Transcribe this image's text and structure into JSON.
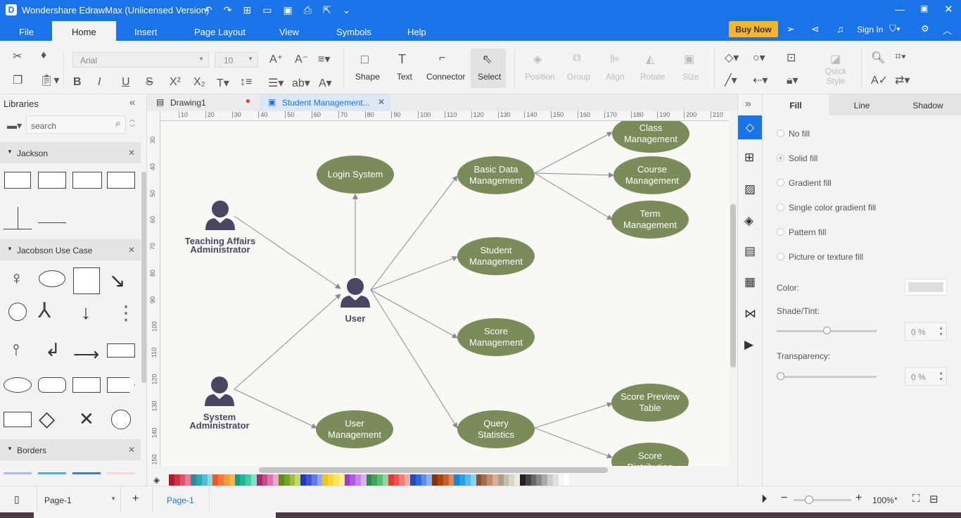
{
  "app": {
    "title": "Wondershare EdrawMax (Unlicensed Version)",
    "buy_now": "Buy Now",
    "sign_in": "Sign In"
  },
  "menu": [
    "File",
    "Home",
    "Insert",
    "Page Layout",
    "View",
    "Symbols",
    "Help"
  ],
  "ribbon": {
    "font": "Arial",
    "size": "10",
    "shape": "Shape",
    "text": "Text",
    "connector": "Connector",
    "select": "Select",
    "position": "Position",
    "group": "Group",
    "align": "Align",
    "rotate": "Rotate",
    "size_lbl": "Size",
    "quick_style": "Quick Style"
  },
  "libraries": {
    "title": "Libraries",
    "search_placeholder": "search",
    "sections": [
      "Jackson",
      "Jacobson Use Case",
      "Borders"
    ]
  },
  "tabs": [
    {
      "label": "Drawing1"
    },
    {
      "label": "Student Management..."
    }
  ],
  "ruler_h": [
    "10",
    "20",
    "30",
    "40",
    "50",
    "60",
    "70",
    "80",
    "90",
    "100",
    "110",
    "120",
    "130",
    "140",
    "150",
    "160",
    "170",
    "180",
    "190",
    "200",
    "210"
  ],
  "ruler_v": [
    "30",
    "40",
    "50",
    "60",
    "70",
    "80",
    "90",
    "100",
    "110",
    "120",
    "130",
    "140",
    "150"
  ],
  "diagram": {
    "actors": [
      {
        "id": "ta",
        "label": "Teaching Affairs Administrator"
      },
      {
        "id": "user",
        "label": "User"
      },
      {
        "id": "sa",
        "label": "System Administrator"
      }
    ],
    "use_cases": [
      {
        "id": "login",
        "label": "Login System"
      },
      {
        "id": "basic",
        "label": "Basic Data Management"
      },
      {
        "id": "class",
        "label": "Class Management"
      },
      {
        "id": "course",
        "label": "Course Management"
      },
      {
        "id": "term",
        "label": "Term Management"
      },
      {
        "id": "student",
        "label": "Student Management"
      },
      {
        "id": "score",
        "label": "Score Management"
      },
      {
        "id": "usermgmt",
        "label": "User Management"
      },
      {
        "id": "query",
        "label": "Query Statistics"
      },
      {
        "id": "preview",
        "label": "Score Preview Table"
      },
      {
        "id": "dist",
        "label": "Score Distribution"
      }
    ],
    "edges": [
      [
        "ta",
        "user"
      ],
      [
        "sa",
        "user"
      ],
      [
        "user",
        "login"
      ],
      [
        "user",
        "basic"
      ],
      [
        "user",
        "student"
      ],
      [
        "user",
        "score"
      ],
      [
        "user",
        "query"
      ],
      [
        "sa",
        "usermgmt"
      ],
      [
        "basic",
        "class"
      ],
      [
        "basic",
        "course"
      ],
      [
        "basic",
        "term"
      ],
      [
        "query",
        "preview"
      ],
      [
        "query",
        "dist"
      ]
    ],
    "node_color": "#7a8c5a",
    "actor_color": "#4a4560",
    "edge_color": "#8a8a96"
  },
  "palette": [
    "#b5172f",
    "#d0314b",
    "#e0546b",
    "#f07a90",
    "#2e8c9a",
    "#35a6b5",
    "#53bfcc",
    "#86dbe6",
    "#f0592a",
    "#f57a35",
    "#f99a3c",
    "#fcb84a",
    "#129b7f",
    "#20b594",
    "#45cba8",
    "#86e0c7",
    "#a02c6b",
    "#c84a8c",
    "#de72ac",
    "#f0a7cc",
    "#5d8a1a",
    "#7aa324",
    "#9dbd3b",
    "#c3d96b",
    "#2439b5",
    "#3a58d6",
    "#6179ea",
    "#94a7f5",
    "#f0c419",
    "#f7d830",
    "#fbe55b",
    "#fdf08e",
    "#9a3ad0",
    "#b05ae0",
    "#c783ee",
    "#dcb0f6",
    "#2f8a48",
    "#3fa35a",
    "#5dbd77",
    "#8fd7a2",
    "#e53935",
    "#ef5350",
    "#f57c73",
    "#f9a7a0",
    "#1e4fb5",
    "#2f6bd8",
    "#5a8de8",
    "#8db0f2",
    "#8a3200",
    "#a8460e",
    "#c4622a",
    "#dc8a5a",
    "#1a86d0",
    "#2aa0e6",
    "#52baf0",
    "#86d2f7",
    "#8a5034",
    "#a86b4c",
    "#c48a6c",
    "#dcae94",
    "#a6a08a",
    "#c2bca8",
    "#dad5c4",
    "#eeeae0",
    "#222222",
    "#444444",
    "#666666",
    "#888888",
    "#aaaaaa",
    "#cccccc",
    "#e0e0e0",
    "#f5f5f5",
    "#ffffff"
  ],
  "right_panel": {
    "tabs": [
      "Fill",
      "Line",
      "Shadow"
    ],
    "options": [
      "No fill",
      "Solid fill",
      "Gradient fill",
      "Single color gradient fill",
      "Pattern fill",
      "Picture or texture fill"
    ],
    "color_label": "Color:",
    "shade_label": "Shade/Tint:",
    "shade_value": "0 %",
    "transparency_label": "Transparency:",
    "transparency_value": "0 %"
  },
  "status": {
    "page_select": "Page-1",
    "page_tab": "Page-1",
    "zoom": "100%"
  }
}
